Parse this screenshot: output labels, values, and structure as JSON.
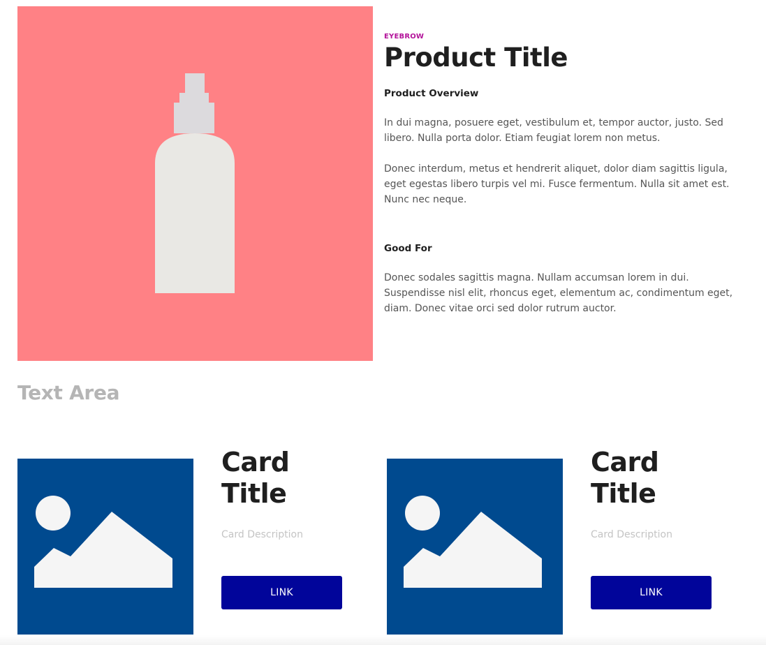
{
  "hero": {
    "eyebrow": "EYEBROW",
    "title": "Product Title",
    "overview_heading": "Product Overview",
    "paragraph_1": "In dui magna, posuere eget, vestibulum et, tempor auctor, justo. Sed libero. Nulla porta dolor. Etiam feugiat lorem non metus.",
    "paragraph_2": "Donec interdum, metus et hendrerit aliquet, dolor diam sagittis ligula, eget egestas libero turpis vel mi. Fusce fermentum. Nulla sit amet est. Nunc nec neque.",
    "good_for_heading": "Good For",
    "paragraph_3": "Donec sodales sagittis magna. Nullam accumsan lorem in dui. Suspendisse nisl elit, rhoncus eget, elementum ac, condimentum eget, diam. Donec vitae orci sed dolor rutrum auctor.",
    "image_icon": "spray-bottle-icon",
    "image_bg_color": "#ff8185"
  },
  "text_area": {
    "label": "Text Area"
  },
  "cards": [
    {
      "title": "Card Title",
      "description": "Card Description",
      "link_label": "LINK",
      "image_icon": "image-placeholder-icon"
    },
    {
      "title": "Card Title",
      "description": "Card Description",
      "link_label": "LINK",
      "image_icon": "image-placeholder-icon"
    }
  ],
  "colors": {
    "eyebrow": "#b3129a",
    "card_image_bg": "#004a8f",
    "link_button_bg": "#01059a",
    "muted_text": "#b5b5b5"
  }
}
